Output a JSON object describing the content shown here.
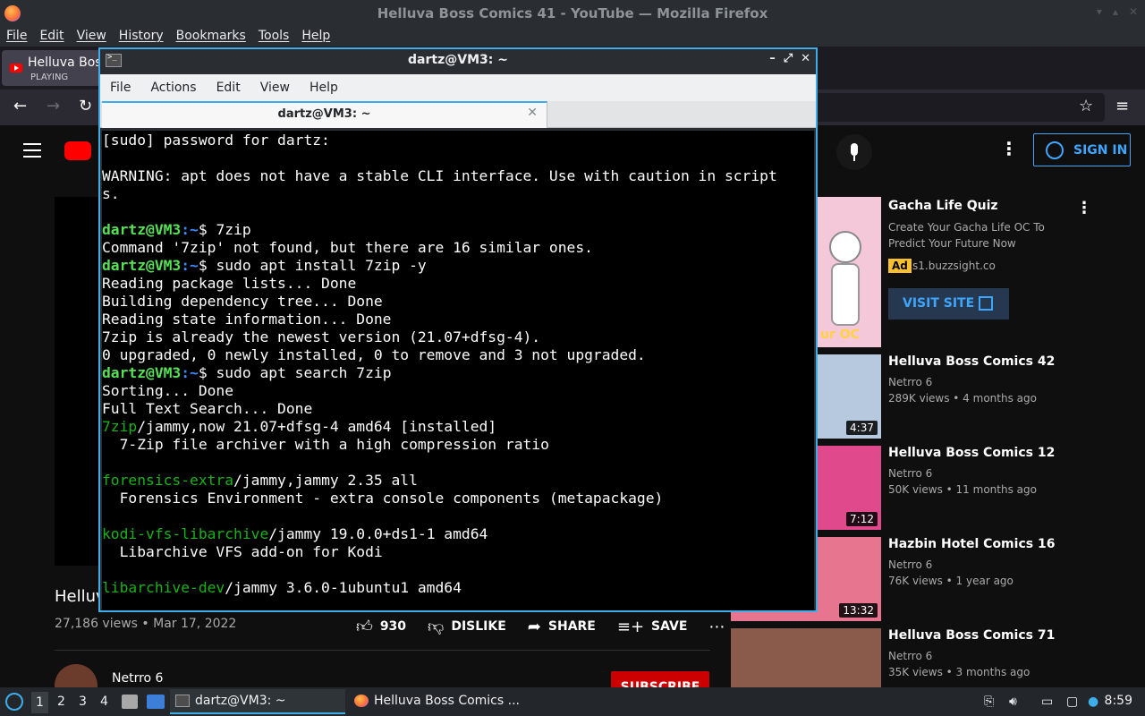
{
  "firefox": {
    "window_title": "Helluva Boss Comics 41 - YouTube — Mozilla Firefox",
    "menu": [
      "File",
      "Edit",
      "View",
      "History",
      "Bookmarks",
      "Tools",
      "Help"
    ],
    "tab": {
      "title": "Helluva Bos",
      "status": "PLAYING"
    }
  },
  "youtube": {
    "signin_label": "SIGN IN",
    "video_title": "Helluv",
    "views_date": "27,186 views • Mar 17, 2022",
    "actions": {
      "likes": "930",
      "dislike": "DISLIKE",
      "share": "SHARE",
      "save": "SAVE"
    },
    "channel": "Netrro 6",
    "subscribe_label": "SUBSCRIBE",
    "ad": {
      "title": "Gacha Life Quiz",
      "description": "Create Your Gacha Life OC To Predict Your Future Now",
      "badge": "Ad",
      "domain": "s1.buzzsight.co",
      "button": "VISIT SITE",
      "thumb_text": "ur OC"
    },
    "recommendations": [
      {
        "title": "Helluva Boss Comics 42",
        "channel": "Netrro 6",
        "meta": "289K views • 4 months ago",
        "duration": "4:37",
        "color": "#b7c9de"
      },
      {
        "title": "Helluva Boss Comics 12",
        "channel": "Netrro 6",
        "meta": "50K views • 11 months ago",
        "duration": "7:12",
        "color": "#e04a8c"
      },
      {
        "title": "Hazbin Hotel Comics 16",
        "channel": "Netrro 6",
        "meta": "76K views • 1 year ago",
        "duration": "13:32",
        "color": "#e8758f"
      },
      {
        "title": "Helluva Boss Comics 71",
        "channel": "Netrro 6",
        "meta": "35K views • 3 months ago",
        "duration": "",
        "color": "#8a5a4a"
      }
    ]
  },
  "terminal": {
    "title": "dartz@VM3: ~",
    "menu": [
      "File",
      "Actions",
      "Edit",
      "View",
      "Help"
    ],
    "tab_label": "dartz@VM3: ~",
    "prompt_user": "dartz@VM3",
    "prompt_path": ":~",
    "lines": [
      {
        "text": "[sudo] password for dartz:"
      },
      {
        "text": ""
      },
      {
        "text": "WARNING: apt does not have a stable CLI interface. Use with caution in script"
      },
      {
        "text": "s."
      },
      {
        "text": ""
      },
      {
        "prompt": true,
        "cmd": "$ 7zip"
      },
      {
        "text": "Command '7zip' not found, but there are 16 similar ones."
      },
      {
        "prompt": true,
        "cmd": "$ sudo apt install 7zip -y"
      },
      {
        "text": "Reading package lists... Done"
      },
      {
        "text": "Building dependency tree... Done"
      },
      {
        "text": "Reading state information... Done"
      },
      {
        "text": "7zip is already the newest version (21.07+dfsg-4)."
      },
      {
        "text": "0 upgraded, 0 newly installed, 0 to remove and 3 not upgraded."
      },
      {
        "prompt": true,
        "cmd": "$ sudo apt search 7zip"
      },
      {
        "text": "Sorting... Done"
      },
      {
        "text": "Full Text Search... Done"
      },
      {
        "pkg": "7zip",
        "rest": "/jammy,now 21.07+dfsg-4 amd64 [installed]"
      },
      {
        "text": "  7-Zip file archiver with a high compression ratio"
      },
      {
        "text": ""
      },
      {
        "pkg": "forensics-extra",
        "rest": "/jammy,jammy 2.35 all"
      },
      {
        "text": "  Forensics Environment - extra console components (metapackage)"
      },
      {
        "text": ""
      },
      {
        "pkg": "kodi-vfs-libarchive",
        "rest": "/jammy 19.0.0+ds1-1 amd64"
      },
      {
        "text": "  Libarchive VFS add-on for Kodi"
      },
      {
        "text": ""
      },
      {
        "pkg": "libarchive-dev",
        "rest": "/jammy 3.6.0-1ubuntu1 amd64"
      }
    ]
  },
  "panel": {
    "workspaces": [
      "1",
      "2",
      "3",
      "4"
    ],
    "tasks": [
      {
        "label": "dartz@VM3: ~",
        "active": true
      },
      {
        "label": "Helluva Boss Comics ...",
        "active": false
      }
    ],
    "clock": "8:59"
  },
  "colors": {
    "accent": "#3daee9",
    "youtube_red": "#ff0000",
    "prompt_green": "#55e155",
    "prompt_blue": "#3d8bff"
  }
}
